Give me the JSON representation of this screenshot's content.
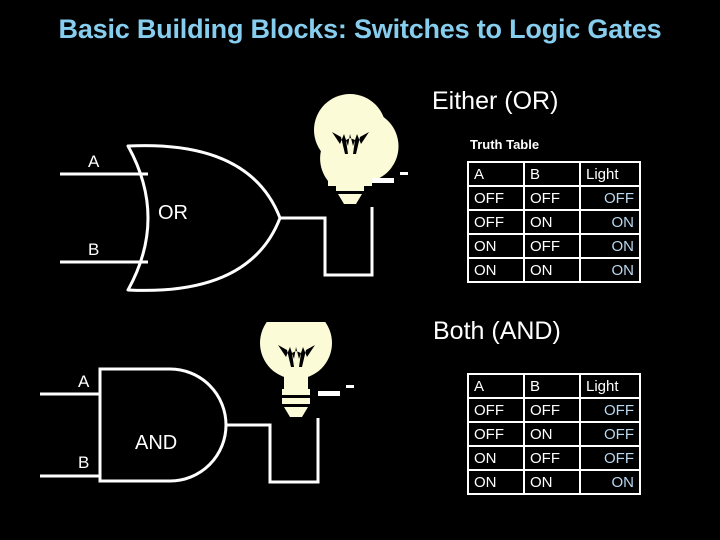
{
  "slide": {
    "title": "Basic Building Blocks: Switches to Logic Gates",
    "title_color": "#86cdee",
    "background_color": "#000000"
  },
  "sections": [
    {
      "id": "or",
      "heading": "Either (OR)",
      "caption": "Truth Table",
      "gate_label": "OR",
      "input_a_label": "A",
      "input_b_label": "B",
      "bulb_name": "light-bulb",
      "table": {
        "headers": [
          "A",
          "B",
          "Light"
        ],
        "rows": [
          [
            "OFF",
            "OFF",
            "OFF"
          ],
          [
            "OFF",
            "ON",
            "ON"
          ],
          [
            "ON",
            "OFF",
            "ON"
          ],
          [
            "ON",
            "ON",
            "ON"
          ]
        ],
        "light_color": "#b9d7ee"
      }
    },
    {
      "id": "and",
      "heading": "Both (AND)",
      "gate_label": "AND",
      "input_a_label": "A",
      "input_b_label": "B",
      "bulb_name": "light-bulb",
      "table": {
        "headers": [
          "A",
          "B",
          "Light"
        ],
        "rows": [
          [
            "OFF",
            "OFF",
            "OFF"
          ],
          [
            "OFF",
            "ON",
            "OFF"
          ],
          [
            "ON",
            "OFF",
            "OFF"
          ],
          [
            "ON",
            "ON",
            "ON"
          ]
        ],
        "light_color": "#b9d7ee"
      }
    }
  ],
  "colors": {
    "wire": "#ffffff",
    "bulb_glass": "#fbfbd8",
    "text": "#ffffff"
  }
}
